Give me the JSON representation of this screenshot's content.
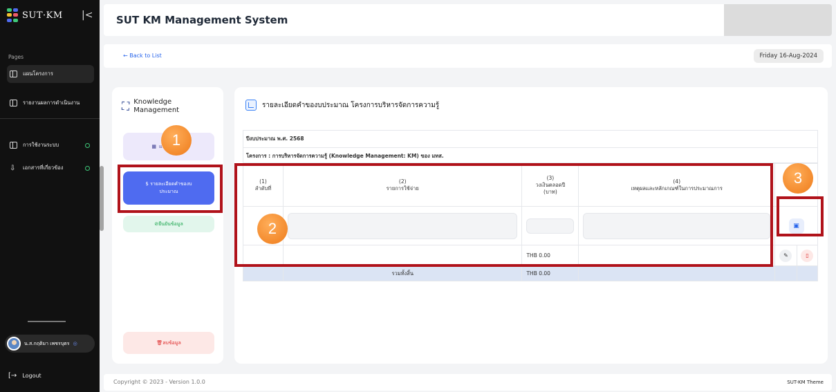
{
  "sidebar": {
    "logo_text": "SUT·KM",
    "collapse_glyph": "|<",
    "section_label": "Pages",
    "items": [
      {
        "label": "แผนโครงการ",
        "icon": "grid-icon"
      },
      {
        "label": "รายงานผลการดำเนินงาน",
        "icon": "report-icon"
      },
      {
        "label": "การใช้งานระบบ",
        "icon": "grid-icon"
      },
      {
        "label": "เอกสารที่เกี่ยวข้อง",
        "icon": "download-icon"
      }
    ],
    "user_name": "น.ส.กฤติมา เพชรบุตร",
    "logout_label": "Logout"
  },
  "header": {
    "title": "SUT KM Management System",
    "back_label": "← Back to List",
    "date": "Friday 16-Aug-2024"
  },
  "left_panel": {
    "title_line1": "Knowledge",
    "title_line2": "Management",
    "step_plan": "แบ… ดำเนิน",
    "step_budget_line1": "รายละเอียดคำของบ",
    "step_budget_line2": "ประมาณ",
    "step_confirm": "ยืนยันข้อมูล",
    "step_delete": "ลบข้อมูล"
  },
  "main": {
    "title": "รายละเอียดคำของบประมาณ โครงการบริหารจัดการความรู้",
    "fiscal_year": "ปีงบประมาณ พ.ศ. 2568",
    "project": "โครงการ : การบริหารจัดการความรู้ (Knowledge Management: KM) ของ มทส.",
    "columns": [
      {
        "num": "(1)",
        "label": "ลำดับที่"
      },
      {
        "num": "(2)",
        "label": "รายการใช้จ่าย"
      },
      {
        "num": "(3)",
        "label": "วงเงินตลอดปี",
        "label2": "(บาท)"
      },
      {
        "num": "(4)",
        "label": "เหตุผลและหลักเกณฑ์ในการประมาณการ"
      }
    ],
    "row_amount": "THB 0.00",
    "total_label": "รวมทั้งสิ้น",
    "total_amount": "THB 0.00"
  },
  "annotations": [
    "1",
    "2",
    "3"
  ],
  "footer": {
    "copyright": "Copyright © 2023 - Version 1.0.0",
    "theme": "SUT-KM Theme"
  },
  "colors": {
    "sidebar_bg": "#111111",
    "primary": "#4f6bf0",
    "annotation_box": "#b0121a",
    "annotation_badge": "#ee7b1a"
  }
}
